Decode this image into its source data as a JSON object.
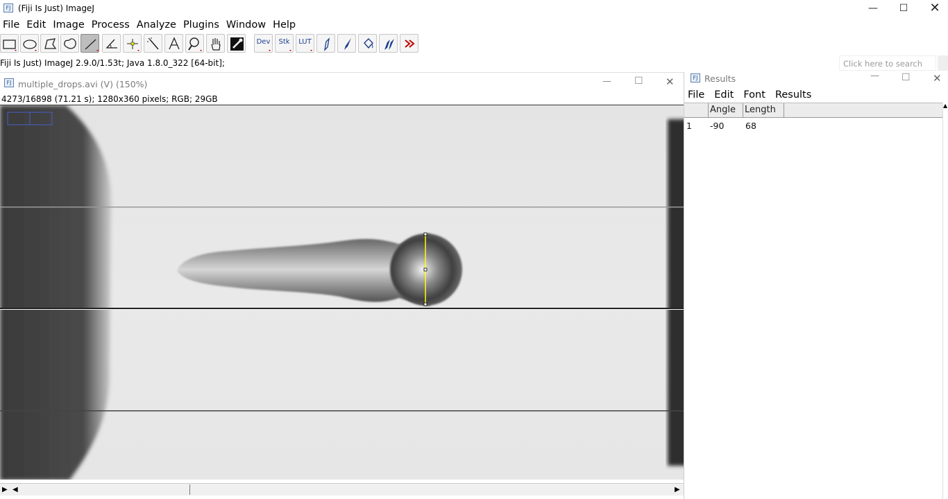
{
  "app": {
    "title": "(Fiji Is Just) ImageJ",
    "menu": [
      "File",
      "Edit",
      "Image",
      "Process",
      "Analyze",
      "Plugins",
      "Window",
      "Help"
    ],
    "status": "Fiji Is Just) ImageJ 2.9.0/1.53t; Java 1.8.0_322 [64-bit];",
    "search_placeholder": "Click here to search"
  },
  "toolbar": {
    "tools": [
      {
        "name": "rectangle-tool",
        "icon": "rectangle-icon"
      },
      {
        "name": "oval-tool",
        "icon": "oval-icon"
      },
      {
        "name": "polygon-tool",
        "icon": "polygon-icon"
      },
      {
        "name": "freehand-tool",
        "icon": "freehand-icon"
      },
      {
        "name": "straight-line-tool",
        "icon": "line-icon",
        "selected": true
      },
      {
        "name": "angle-tool",
        "icon": "angle-icon"
      },
      {
        "name": "point-tool",
        "icon": "crosshair-icon"
      },
      {
        "name": "wand-tool",
        "icon": "wand-icon"
      },
      {
        "name": "text-tool",
        "icon": "text-icon"
      },
      {
        "name": "magnifier-tool",
        "icon": "magnifier-icon"
      },
      {
        "name": "scrolling-tool",
        "icon": "hand-icon"
      },
      {
        "name": "color-picker-tool",
        "icon": "dropper-icon"
      }
    ],
    "dev_label": "Dev",
    "stk_label": "Stk",
    "lut_label": "LUT"
  },
  "image_window": {
    "title": "multiple_drops.avi (V) (150%)",
    "info": "4273/16898 (71.21 s); 1280x360 pixels; RGB; 29GB"
  },
  "results_window": {
    "title": "Results",
    "menu": [
      "File",
      "Edit",
      "Font",
      "Results"
    ],
    "columns": [
      "",
      "Angle",
      "Length"
    ],
    "rows": [
      {
        "index": "1",
        "angle": "-90",
        "length": "68"
      }
    ]
  },
  "colors": {
    "selection_line": "#ffff00",
    "tool_text": "#1b3e8f",
    "more_tools_arrow": "#c00000"
  }
}
